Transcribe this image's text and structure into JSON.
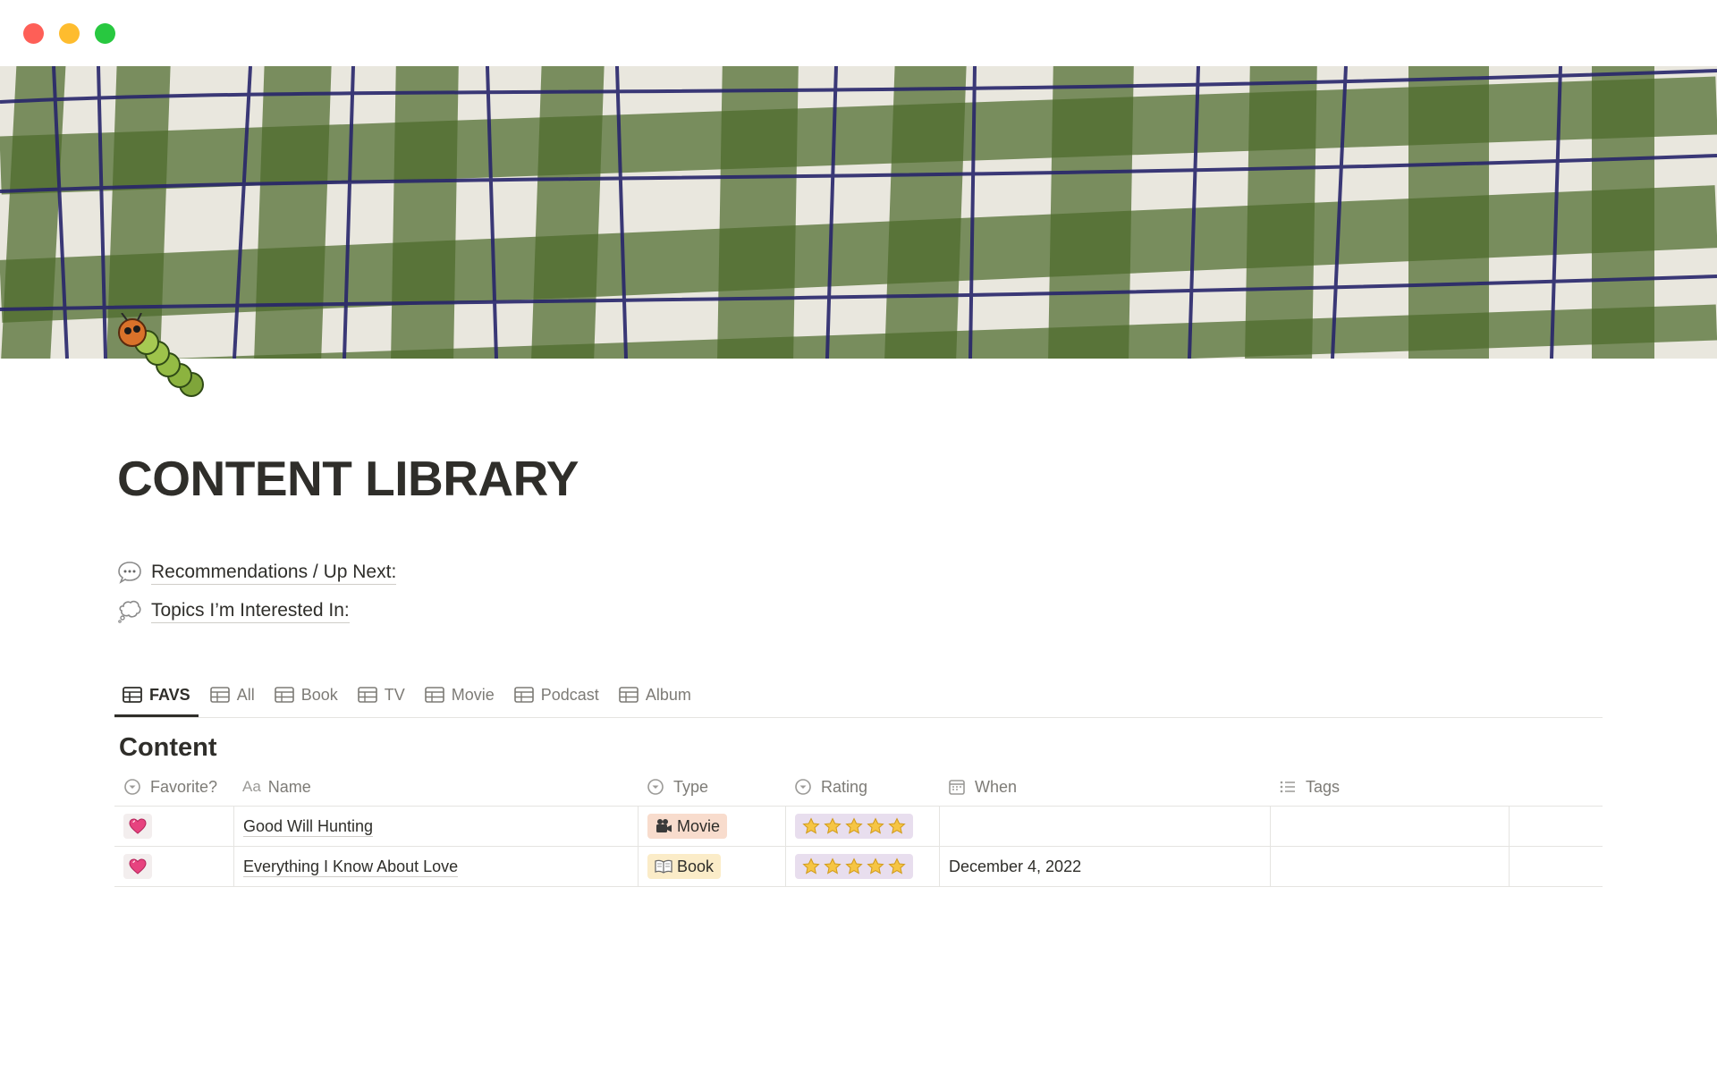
{
  "window": {
    "controls": [
      "close",
      "minimize",
      "zoom"
    ]
  },
  "cover": {
    "pattern": "green-gingham",
    "colors": {
      "base": "#e9e7de",
      "stripe": "#4d6b2c",
      "thread": "#27256b"
    }
  },
  "page": {
    "icon": "caterpillar-icon",
    "title": "CONTENT LIBRARY",
    "links": [
      {
        "icon": "speech-bubble-icon",
        "label": "Recommendations / Up Next:"
      },
      {
        "icon": "thought-bubble-icon",
        "label": "Topics I’m Interested In:"
      }
    ]
  },
  "views": {
    "active": "FAVS",
    "tabs": [
      {
        "label": "FAVS",
        "icon": "table-icon"
      },
      {
        "label": "All",
        "icon": "table-icon"
      },
      {
        "label": "Book",
        "icon": "table-icon"
      },
      {
        "label": "TV",
        "icon": "table-icon"
      },
      {
        "label": "Movie",
        "icon": "table-icon"
      },
      {
        "label": "Podcast",
        "icon": "table-icon"
      },
      {
        "label": "Album",
        "icon": "table-icon"
      }
    ]
  },
  "database": {
    "title": "Content",
    "columns": {
      "favorite": "Favorite?",
      "name_prefix": "Aa",
      "name": "Name",
      "type": "Type",
      "rating": "Rating",
      "when": "When",
      "tags": "Tags"
    },
    "rows": [
      {
        "favorite": "heart-icon",
        "name": "Good Will Hunting",
        "type": "Movie",
        "type_icon": "film-camera-icon",
        "rating_stars": 5,
        "when": "",
        "tags": ""
      },
      {
        "favorite": "heart-icon",
        "name": "Everything I Know About Love",
        "type": "Book",
        "type_icon": "open-book-icon",
        "rating_stars": 5,
        "when": "December 4, 2022",
        "tags": ""
      }
    ]
  }
}
